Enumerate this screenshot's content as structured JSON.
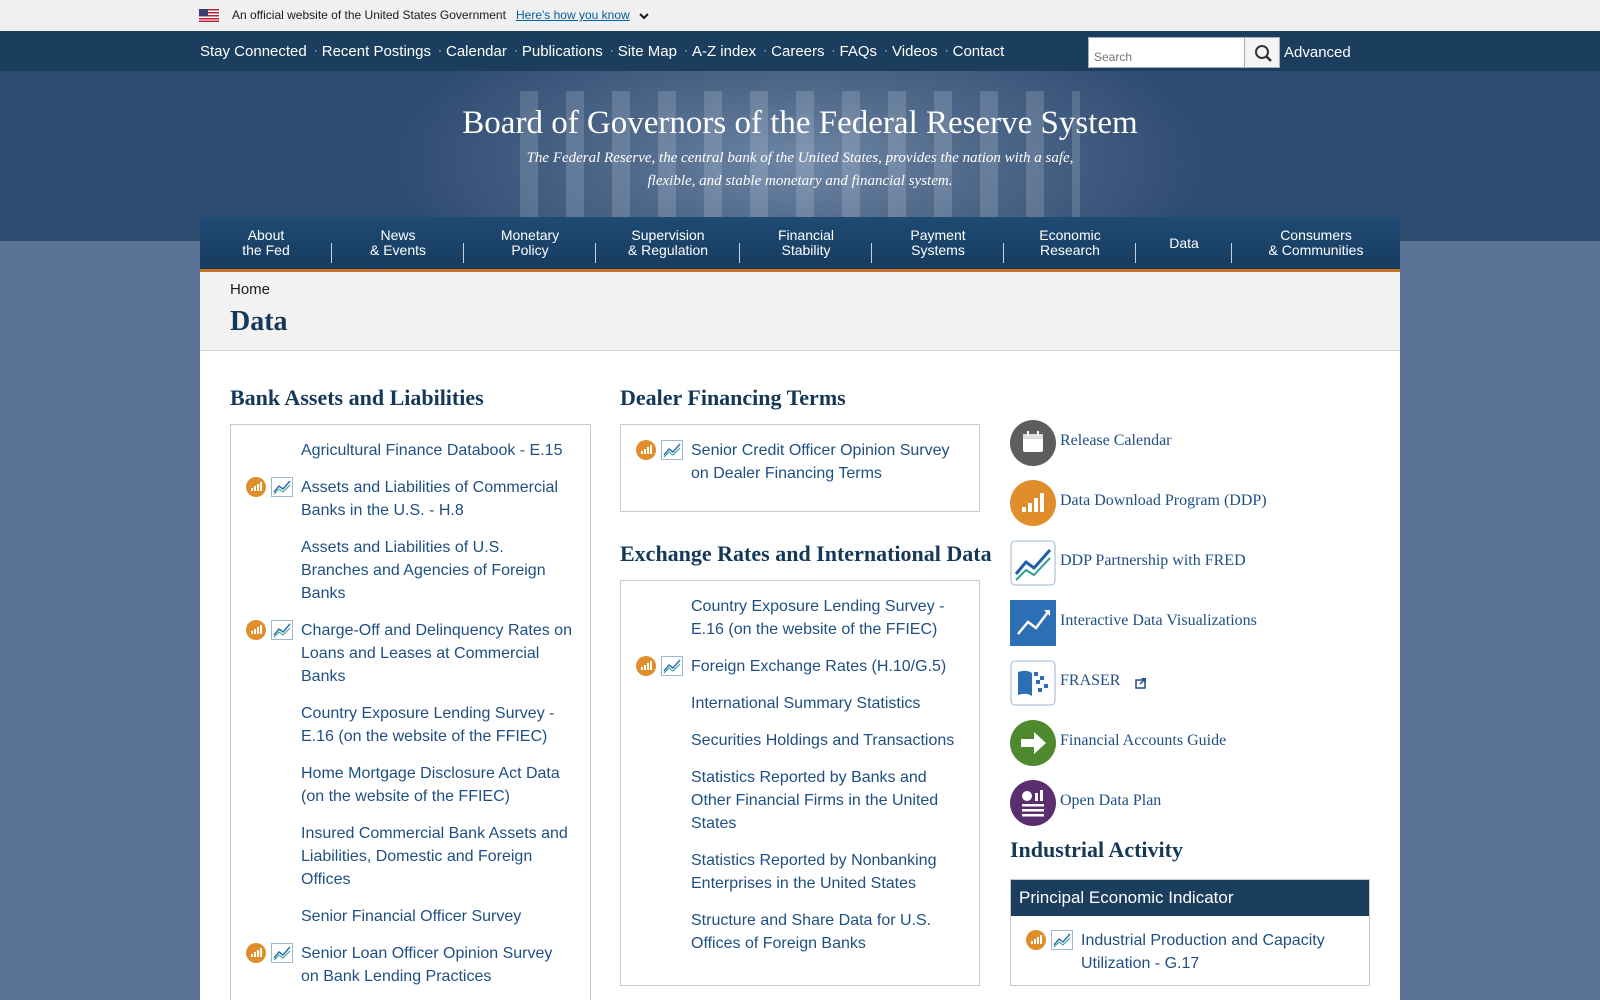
{
  "banner": {
    "text": "An official website of the United States Government",
    "link": "Here's how you know"
  },
  "utility": {
    "links": [
      "Stay Connected",
      "Recent Postings",
      "Calendar",
      "Publications",
      "Site Map",
      "A-Z index",
      "Careers",
      "FAQs",
      "Videos",
      "Contact"
    ],
    "search_placeholder": "Search",
    "advanced": "Advanced"
  },
  "masthead": {
    "title": "Board of Governors of the Federal Reserve System",
    "tagline_line1": "The Federal Reserve, the central bank of the United States, provides the nation with a safe,",
    "tagline_line2": "flexible, and stable monetary and financial system."
  },
  "nav": [
    {
      "line1": "About",
      "line2": "the Fed"
    },
    {
      "line1": "News",
      "line2": "& Events"
    },
    {
      "line1": "Monetary",
      "line2": "Policy"
    },
    {
      "line1": "Supervision",
      "line2": "& Regulation"
    },
    {
      "line1": "Financial",
      "line2": "Stability"
    },
    {
      "line1": "Payment",
      "line2": "Systems"
    },
    {
      "line1": "Economic",
      "line2": "Research"
    },
    {
      "line1": "Data",
      "line2": ""
    },
    {
      "line1": "Consumers",
      "line2": "& Communities"
    }
  ],
  "breadcrumb": "Home",
  "page_title": "Data",
  "bank_assets": {
    "heading": "Bank Assets and Liabilities",
    "items": [
      {
        "line1": "Agricultural Finance Databook - E.15",
        "icons": false
      },
      {
        "line1": "Assets and Liabilities of Commercial",
        "line2": "Banks in the U.S. - H.8",
        "icons": true
      },
      {
        "line1": "Assets and Liabilities of U.S.",
        "line2": "Branches and Agencies of Foreign",
        "line3": "Banks",
        "icons": false
      },
      {
        "line1": "Charge-Off and Delinquency Rates on",
        "line2": "Loans and Leases at Commercial",
        "line3": "Banks",
        "icons": true
      },
      {
        "line1": "Country Exposure Lending Survey -",
        "line2": "E.16 (on the website of the FFIEC)",
        "icons": false
      },
      {
        "line1": "Home Mortgage Disclosure Act Data",
        "line2": "(on the website of the FFIEC)",
        "icons": false
      },
      {
        "line1": "Insured Commercial Bank Assets and",
        "line2": "Liabilities, Domestic and Foreign",
        "line3": "Offices",
        "icons": false
      },
      {
        "line1": "Senior Financial Officer Survey",
        "icons": false
      },
      {
        "line1": "Senior Loan Officer Opinion Survey",
        "line2": "on Bank Lending Practices",
        "icons": true
      }
    ]
  },
  "dealer": {
    "heading": "Dealer Financing Terms",
    "items": [
      {
        "line1": "Senior Credit Officer Opinion Survey",
        "line2": "on Dealer Financing Terms",
        "icons": true
      }
    ]
  },
  "exchange": {
    "heading": "Exchange Rates and International Data",
    "items": [
      {
        "line1": "Country Exposure Lending Survey -",
        "line2": "E.16 (on the website of the FFIEC)",
        "icons": false
      },
      {
        "line1": "Foreign Exchange Rates (H.10/G.5)",
        "icons": true
      },
      {
        "line1": "International Summary Statistics",
        "icons": false
      },
      {
        "line1": "Securities Holdings and Transactions",
        "icons": false
      },
      {
        "line1": "Statistics Reported by Banks and",
        "line2": "Other Financial Firms in the United",
        "line3": "States",
        "icons": false
      },
      {
        "line1": "Statistics Reported by Nonbanking",
        "line2": "Enterprises in the United States",
        "icons": false
      },
      {
        "line1": "Structure and Share Data for U.S.",
        "line2": "Offices of Foreign Banks",
        "icons": false
      }
    ]
  },
  "tools": [
    {
      "label": "Release Calendar",
      "icon": "calendar-icon",
      "color": "#5d5d5d"
    },
    {
      "label": "Data Download Program (DDP)",
      "icon": "ddp-icon",
      "color": "#e08e2b"
    },
    {
      "label": "DDP Partnership with FRED",
      "icon": "fred-icon",
      "color": "#1f5fa8"
    },
    {
      "label": "Interactive Data Visualizations",
      "icon": "visualization-icon",
      "color": "#2d6fb4"
    },
    {
      "label": "FRASER",
      "icon": "fraser-icon",
      "color": "#2d6fb4"
    },
    {
      "label": "Financial Accounts Guide",
      "icon": "arrow-right-icon",
      "color": "#4e8a2d"
    },
    {
      "label": "Open Data Plan",
      "icon": "open-data-icon",
      "color": "#5b2f6f"
    }
  ],
  "industrial": {
    "heading": "Industrial Activity",
    "subhead": "Principal Economic Indicator",
    "items": [
      {
        "line1": "Industrial Production and Capacity",
        "line2": "Utilization - G.17",
        "icons": true
      }
    ]
  },
  "colors": {
    "accent": "#c8722a",
    "navy": "#1b3d5e",
    "link": "#1f4f82",
    "ddp_orange": "#e08e2b"
  }
}
